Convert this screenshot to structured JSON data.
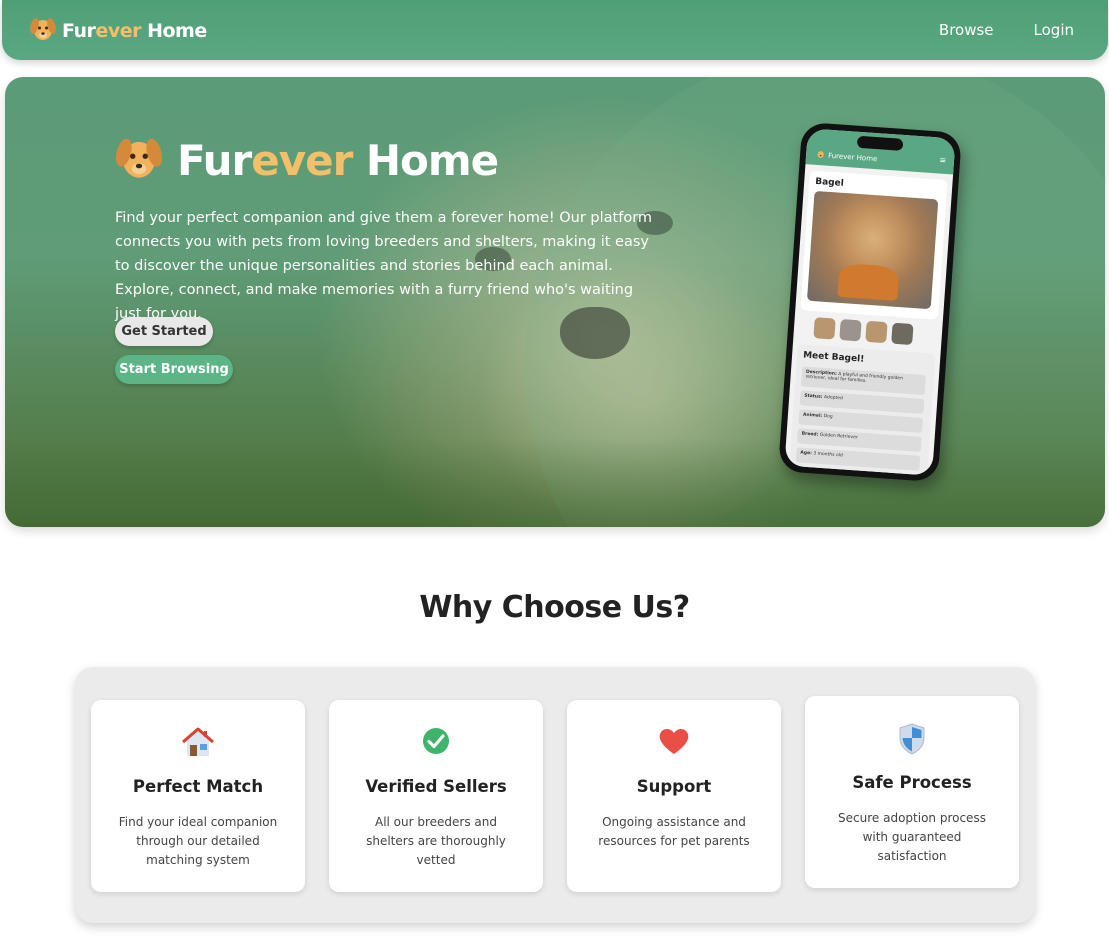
{
  "app": {
    "brand_part1": "Fur",
    "brand_part2": "ever",
    "brand_part3": " Home",
    "accent_color": "#f4bf6a",
    "primary_color": "#5aa883"
  },
  "navbar": {
    "links": [
      {
        "label": "Browse"
      },
      {
        "label": "Login"
      }
    ]
  },
  "hero": {
    "title_part1": "Fur",
    "title_part2": "ever",
    "title_part3": " Home",
    "description": "Find your perfect companion and give them a forever home! Our platform connects you with pets from loving breeders and shelters, making it easy to discover the unique personalities and stories behind each animal. Explore, connect, and make memories with a furry friend who's waiting just for you.",
    "get_started_label": "Get Started",
    "start_browsing_label": "Start Browsing"
  },
  "phone_preview": {
    "brand": "Furever Home",
    "menu_icon": "hamburger-menu-icon",
    "pet_name": "Bagel",
    "meet_title": "Meet Bagel!",
    "details": [
      {
        "label": "Description:",
        "value": "A playful and friendly golden retriever, ideal for families."
      },
      {
        "label": "Status:",
        "value": "Adopted"
      },
      {
        "label": "Animal:",
        "value": "Dog"
      },
      {
        "label": "Breed:",
        "value": "Golden Retriever"
      },
      {
        "label": "Age:",
        "value": "3 months old"
      }
    ]
  },
  "features": {
    "title": "Why Choose Us?",
    "items": [
      {
        "icon": "house-icon",
        "title": "Perfect Match",
        "description": "Find your ideal companion through our detailed matching system"
      },
      {
        "icon": "check-circle-icon",
        "title": "Verified Sellers",
        "description": "All our breeders and shelters are thoroughly vetted"
      },
      {
        "icon": "heart-icon",
        "title": "Support",
        "description": "Ongoing assistance and resources for pet parents"
      },
      {
        "icon": "shield-icon",
        "title": "Safe Process",
        "description": "Secure adoption process with guaranteed satisfaction"
      }
    ]
  }
}
